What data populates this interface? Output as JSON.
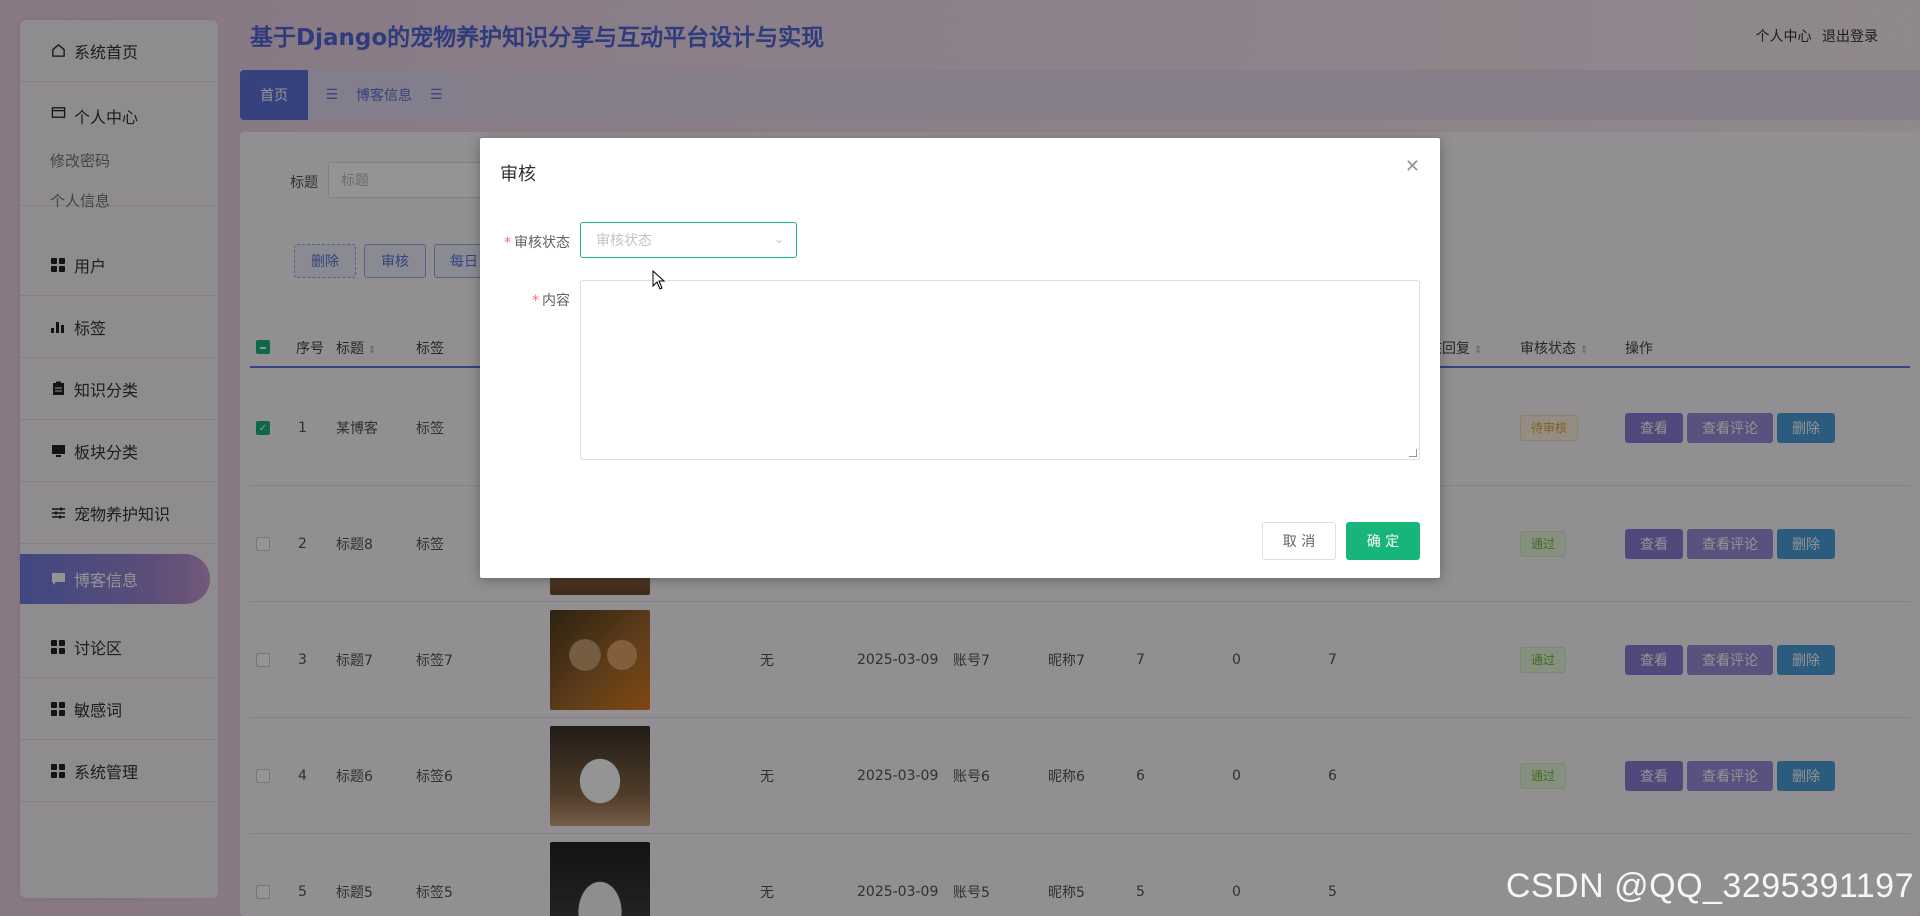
{
  "header": {
    "title": "基于Django的宠物养护知识分享与互动平台设计与实现",
    "links": [
      "个人中心",
      "退出登录"
    ]
  },
  "tabs": {
    "home": "首页",
    "current": "博客信息"
  },
  "sidebar": {
    "items": [
      {
        "label": "系统首页",
        "icon": "home-icon"
      },
      {
        "label": "个人中心",
        "icon": "card-icon"
      },
      {
        "label": "用户",
        "icon": "grid-icon"
      },
      {
        "label": "标签",
        "icon": "bar-chart-icon"
      },
      {
        "label": "知识分类",
        "icon": "clipboard-icon"
      },
      {
        "label": "板块分类",
        "icon": "monitor-icon"
      },
      {
        "label": "宠物养护知识",
        "icon": "sliders-icon"
      },
      {
        "label": "博客信息",
        "icon": "chat-icon"
      },
      {
        "label": "讨论区",
        "icon": "grid-icon"
      },
      {
        "label": "敏感词",
        "icon": "grid-icon"
      },
      {
        "label": "系统管理",
        "icon": "grid-icon"
      }
    ],
    "sub_items": [
      "修改密码",
      "个人信息"
    ]
  },
  "search": {
    "label": "标题",
    "placeholder": "标题"
  },
  "actions": [
    "删除",
    "审核",
    "每日"
  ],
  "table": {
    "headers": {
      "index": "序号",
      "title": "标题",
      "tag": "标签",
      "reply": "核回复",
      "status": "审核状态",
      "ops": "操作"
    },
    "rows": [
      {
        "index": "1",
        "title": "某博客",
        "tag": "标签",
        "status": "待审核",
        "checked": true
      },
      {
        "index": "2",
        "title": "标题8",
        "tag": "标签",
        "status": "通过",
        "checked": false
      },
      {
        "index": "3",
        "title": "标题7",
        "tag": "标签7",
        "misc": "无",
        "date": "2025-03-09",
        "account": "账号7",
        "nickname": "昵称7",
        "n1": "7",
        "n2": "0",
        "n3": "7",
        "status": "通过",
        "checked": false
      },
      {
        "index": "4",
        "title": "标题6",
        "tag": "标签6",
        "misc": "无",
        "date": "2025-03-09",
        "account": "账号6",
        "nickname": "昵称6",
        "n1": "6",
        "n2": "0",
        "n3": "6",
        "status": "通过",
        "checked": false
      },
      {
        "index": "5",
        "title": "标题5",
        "tag": "标签5",
        "misc": "无",
        "date": "2025-03-09",
        "account": "账号5",
        "nickname": "昵称5",
        "n1": "5",
        "n2": "0",
        "n3": "5",
        "status": "",
        "checked": false
      }
    ],
    "op_labels": {
      "view": "查看",
      "comments": "查看评论",
      "delete": "删除"
    }
  },
  "modal": {
    "title": "审核",
    "status_label": "审核状态",
    "status_placeholder": "审核状态",
    "content_label": "内容",
    "cancel": "取 消",
    "confirm": "确 定"
  },
  "watermark": "CSDN @QQ_3295391197",
  "colors": {
    "primary": "#5e72d8",
    "confirm": "#17b57a",
    "pass": "#67c23a",
    "pending": "#e6a23c"
  }
}
